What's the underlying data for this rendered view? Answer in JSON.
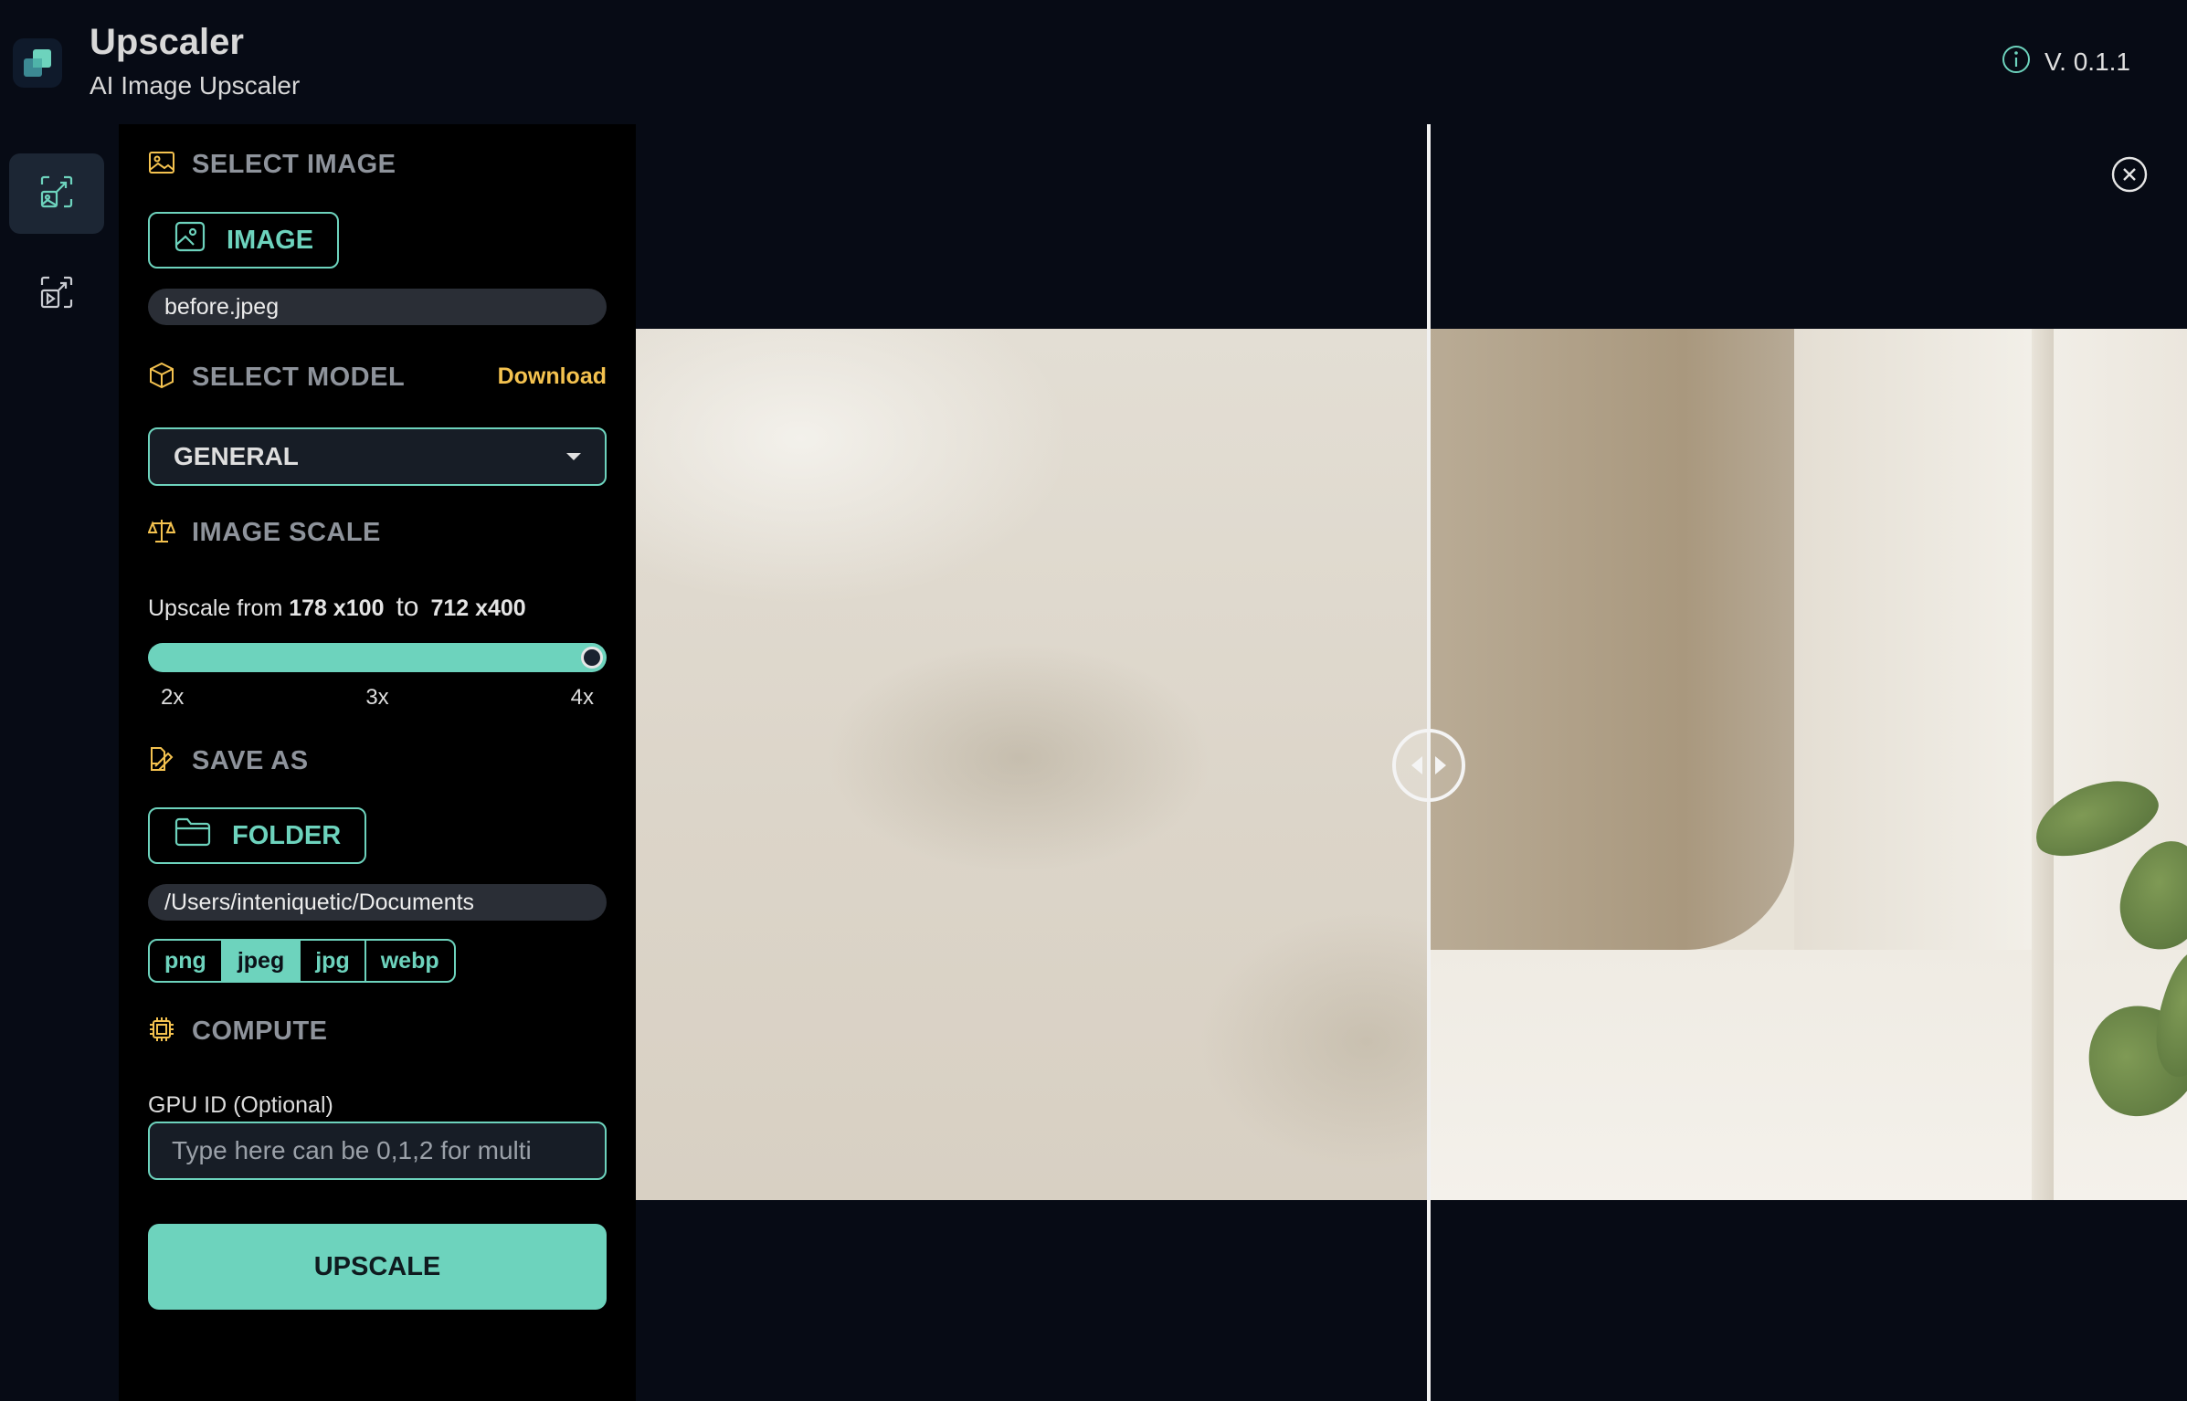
{
  "header": {
    "title": "Upscaler",
    "subtitle": "AI Image Upscaler",
    "version": "V. 0.1.1"
  },
  "rail": {
    "items": [
      {
        "icon": "image-upscale-icon",
        "active": true
      },
      {
        "icon": "video-upscale-icon",
        "active": false
      }
    ]
  },
  "panel": {
    "select_image": {
      "heading": "SELECT IMAGE",
      "button_label": "IMAGE",
      "file_name": "before.jpeg"
    },
    "select_model": {
      "heading": "SELECT MODEL",
      "download_label": "Download",
      "selected": "GENERAL"
    },
    "image_scale": {
      "heading": "IMAGE SCALE",
      "prefix": "Upscale from",
      "from": "178 x100",
      "to_word": "to",
      "to": "712 x400",
      "value": "4x",
      "ticks": [
        "2x",
        "3x",
        "4x"
      ]
    },
    "save_as": {
      "heading": "SAVE AS",
      "button_label": "FOLDER",
      "path": "/Users/inteniquetic/Documents",
      "formats": [
        "png",
        "jpeg",
        "jpg",
        "webp"
      ],
      "selected_format": "jpeg"
    },
    "compute": {
      "heading": "COMPUTE",
      "gpu_label": "GPU ID (Optional)",
      "gpu_placeholder": "Type here can be 0,1,2 for multi",
      "gpu_value": ""
    },
    "upscale_label": "UPSCALE"
  },
  "viewer": {
    "split_fraction": 0.51
  },
  "colors": {
    "accent": "#6dd3bd",
    "download": "#f4c24f",
    "background": "#070b15",
    "panel": "#000000"
  }
}
